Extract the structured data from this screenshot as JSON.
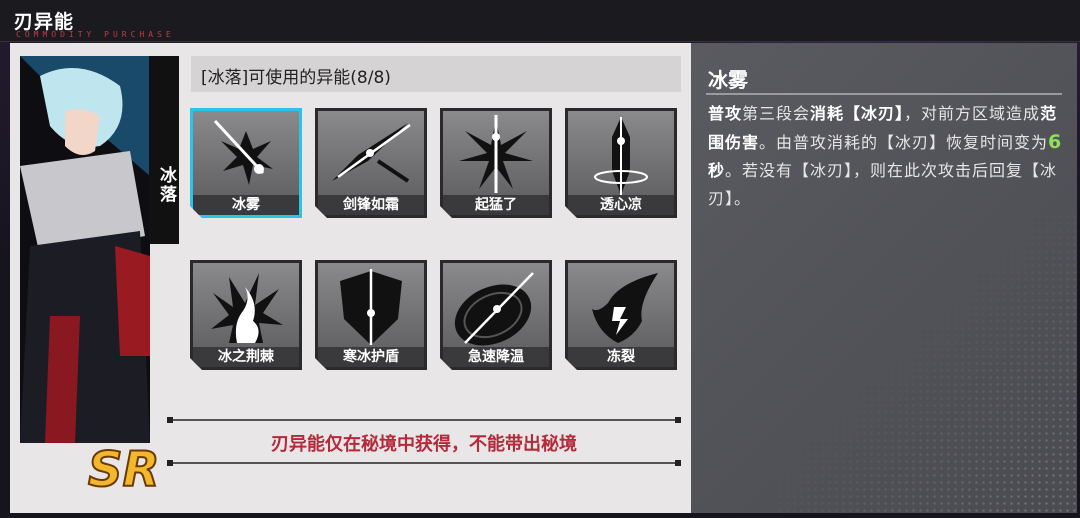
{
  "header": {
    "title": "刃异能",
    "subtitle": "COMMODITY PURCHASE"
  },
  "character": {
    "name": "冰落",
    "rarity": "SR"
  },
  "list": {
    "heading": "[冰落]可使用的异能(8/8)"
  },
  "skills": [
    {
      "label": "冰雾",
      "icon": "ice-mist-icon",
      "selected": true
    },
    {
      "label": "剑锋如霜",
      "icon": "frost-blade-icon"
    },
    {
      "label": "起猛了",
      "icon": "sword-burst-icon"
    },
    {
      "label": "透心凉",
      "icon": "ice-cross-sword-icon"
    },
    {
      "label": "冰之荆棘",
      "icon": "ice-thorn-icon"
    },
    {
      "label": "寒冰护盾",
      "icon": "ice-shield-icon"
    },
    {
      "label": "急速降温",
      "icon": "rapid-cooling-icon"
    },
    {
      "label": "冻裂",
      "icon": "freeze-crack-icon"
    }
  ],
  "notice": "刃异能仅在秘境中获得，不能带出秘境",
  "detail": {
    "title": "冰雾",
    "d1": "普攻",
    "d2": "第三段会",
    "d3": "消耗【冰刃】",
    "d4": "，对前方区域造成",
    "d5": "范围伤害",
    "d6": "。由普攻消耗的【冰刃】恢复时间变为",
    "d7": "6",
    "d8": "秒",
    "d9": "。若没有【冰刃】，则在此次攻击后回复【冰刃】。"
  },
  "colors": {
    "accent": "#2bc3e8",
    "notice": "#b32a3a",
    "highlight": "#8ee05a"
  }
}
